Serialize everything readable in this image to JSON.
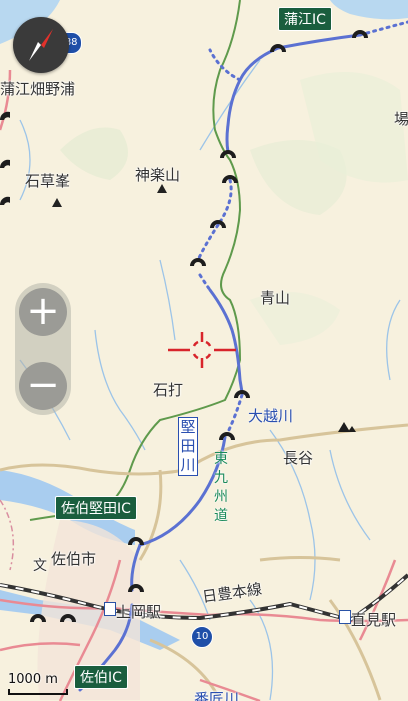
{
  "map": {
    "labels": {
      "kamaeic_top": "蒲江IC",
      "kamae_hatano": "蒲江畑野浦",
      "ishikusamine": "石草峯",
      "kaguraya": "神楽山",
      "aoyama": "青山",
      "ishiuchi": "石打",
      "okoshigawa": "大越川",
      "hase": "長谷",
      "saiki_katada_ic": "佐伯堅田IC",
      "saiki_city": "佐伯市",
      "kamioka_station": "上岡駅",
      "nippo_line": "日豊本線",
      "naomi_station": "直見駅",
      "saiki_ic": "佐伯IC",
      "katada_river": "堅田川",
      "higashi_kyushu_road": "東九州道",
      "ba_edge": "場",
      "bunkyo_mark": "文",
      "bottom_cut": "番匠川"
    },
    "shields": {
      "route_388": "388",
      "route_10": "10"
    },
    "scale": {
      "label": "1000 m"
    },
    "controls": {
      "zoom_in": "+",
      "zoom_out": "−"
    }
  }
}
